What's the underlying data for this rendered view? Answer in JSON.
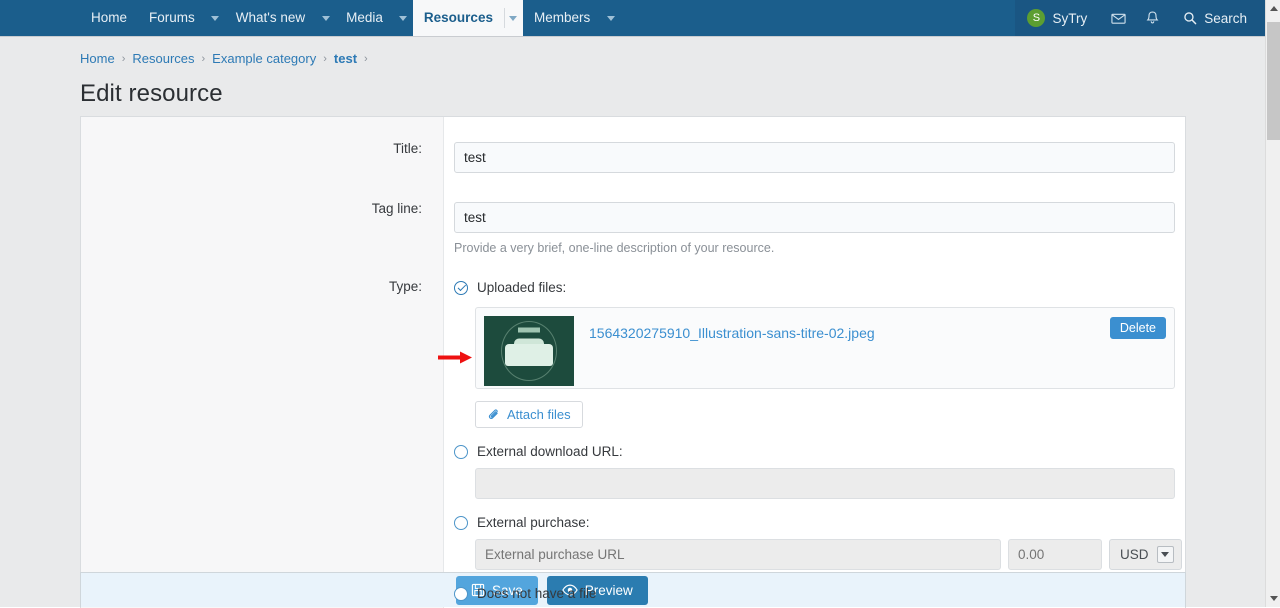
{
  "navbar": {
    "items": [
      {
        "label": "Home",
        "has_caret": false,
        "active": false
      },
      {
        "label": "Forums",
        "has_caret": true,
        "active": false
      },
      {
        "label": "What's new",
        "has_caret": true,
        "active": false
      },
      {
        "label": "Media",
        "has_caret": true,
        "active": false
      },
      {
        "label": "Resources",
        "has_caret": true,
        "active": true
      },
      {
        "label": "Members",
        "has_caret": true,
        "active": false
      }
    ],
    "user": {
      "name": "SyTry",
      "avatar_initial": "S",
      "avatar_color": "#5c9e31"
    },
    "mail_icon": "envelope-icon",
    "alerts_icon": "bell-icon",
    "search_label": "Search",
    "background_color": "#1b5e8c"
  },
  "breadcrumb": {
    "items": [
      "Home",
      "Resources",
      "Example category",
      "test"
    ],
    "separator": "›"
  },
  "page": {
    "title": "Edit resource"
  },
  "form": {
    "title_row": {
      "label": "Title:",
      "value": "test"
    },
    "tagline_row": {
      "label": "Tag line:",
      "value": "test",
      "hint": "Provide a very brief, one-line description of your resource."
    },
    "type_row": {
      "label": "Type:",
      "options": [
        {
          "label": "Uploaded files:",
          "selected": true
        },
        {
          "label": "External download URL:",
          "selected": false
        },
        {
          "label": "External purchase:",
          "selected": false
        },
        {
          "label": "Does not have a file",
          "selected": false
        }
      ],
      "uploaded_file": {
        "name": "1564320275910_Illustration-sans-titre-02.jpeg",
        "delete_label": "Delete",
        "thumbnail_bg": "#1d4b3d"
      },
      "attach_button": "Attach files",
      "external_download_url": {
        "value": "",
        "placeholder": ""
      },
      "external_purchase": {
        "url_placeholder": "External purchase URL",
        "price_placeholder": "0.00",
        "currency": "USD"
      }
    }
  },
  "actions": {
    "save_label": "Save",
    "preview_label": "Preview",
    "save_color": "#53a5dd",
    "preview_color": "#2b7cb0"
  },
  "annotation": {
    "arrow_color": "#ee1111"
  }
}
